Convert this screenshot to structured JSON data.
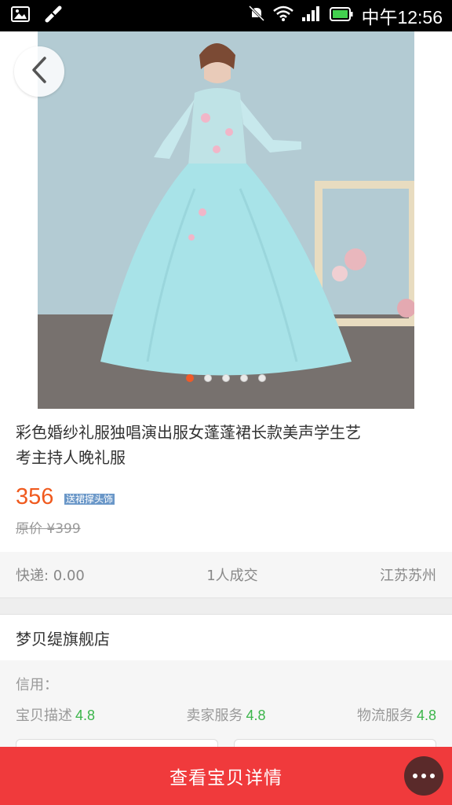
{
  "status_bar": {
    "time": "中午12:56",
    "icons": [
      "image-icon",
      "usb-debug-icon",
      "mute-icon",
      "wifi-icon",
      "signal-icon",
      "battery-icon"
    ]
  },
  "gallery": {
    "image_count": 5,
    "active_index": 0
  },
  "product": {
    "title": "彩色婚纱礼服独唱演出服女蓬蓬裙长款美声学生艺考主持人晚礼服",
    "price": "356",
    "promo_tag": "送裙撑头饰",
    "original_price": "原价 ¥399"
  },
  "meta": {
    "shipping": "快递: 0.00",
    "sales": "1人成交",
    "location": "江苏苏州"
  },
  "shop": {
    "name": "梦贝缇旗舰店",
    "credit_label": "信用：",
    "ratings": [
      {
        "label": "宝贝描述",
        "value": "4.8"
      },
      {
        "label": "卖家服务",
        "value": "4.8"
      },
      {
        "label": "物流服务",
        "value": "4.8"
      }
    ]
  },
  "cta": {
    "label": "查看宝贝详情"
  },
  "colors": {
    "accent": "#f05a1e",
    "cta": "#f03a3c",
    "rating": "#3bb54a"
  }
}
